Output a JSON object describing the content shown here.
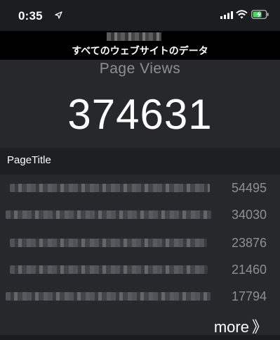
{
  "status_bar": {
    "time": "0:35"
  },
  "header": {
    "subtitle": "すべてのウェブサイトのデータ"
  },
  "summary": {
    "label": "Page Views",
    "value": "374631"
  },
  "table": {
    "column_header": "PageTitle",
    "rows": [
      {
        "value": "54495"
      },
      {
        "value": "34030"
      },
      {
        "value": "23876"
      },
      {
        "value": "21460"
      },
      {
        "value": "17794"
      }
    ]
  },
  "more_link": {
    "label": "more",
    "arrow": "》"
  }
}
